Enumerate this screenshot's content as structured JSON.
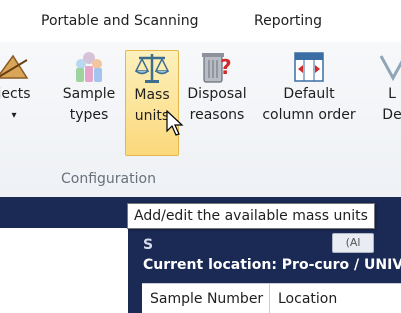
{
  "tabs": {
    "portable": "Portable and Scanning",
    "reporting": "Reporting"
  },
  "ribbon": {
    "buttons": [
      {
        "id": "objects",
        "line1": "jects",
        "line2": "▾",
        "icon": "objects-icon"
      },
      {
        "id": "sample_types",
        "line1": "Sample",
        "line2": "types",
        "icon": "sample-types-icon"
      },
      {
        "id": "mass_units",
        "line1": "Mass",
        "line2": "units",
        "icon": "scales-icon"
      },
      {
        "id": "disposal",
        "line1": "Disposal",
        "line2": "reasons",
        "icon": "disposal-bin-icon"
      },
      {
        "id": "default_order",
        "line1": "Default",
        "line2": "column order",
        "icon": "column-order-icon"
      },
      {
        "id": "l",
        "line1": "L",
        "line2": "De",
        "icon": "partial-icon"
      }
    ],
    "group_label": "Configuration"
  },
  "tooltip": "Add/edit the available mass units",
  "content": {
    "obscured_text": "S",
    "dropdown": "(Al",
    "location": "Current location: Pro-curo / UNIV",
    "table_headers": [
      "Sample Number",
      "Location"
    ]
  }
}
